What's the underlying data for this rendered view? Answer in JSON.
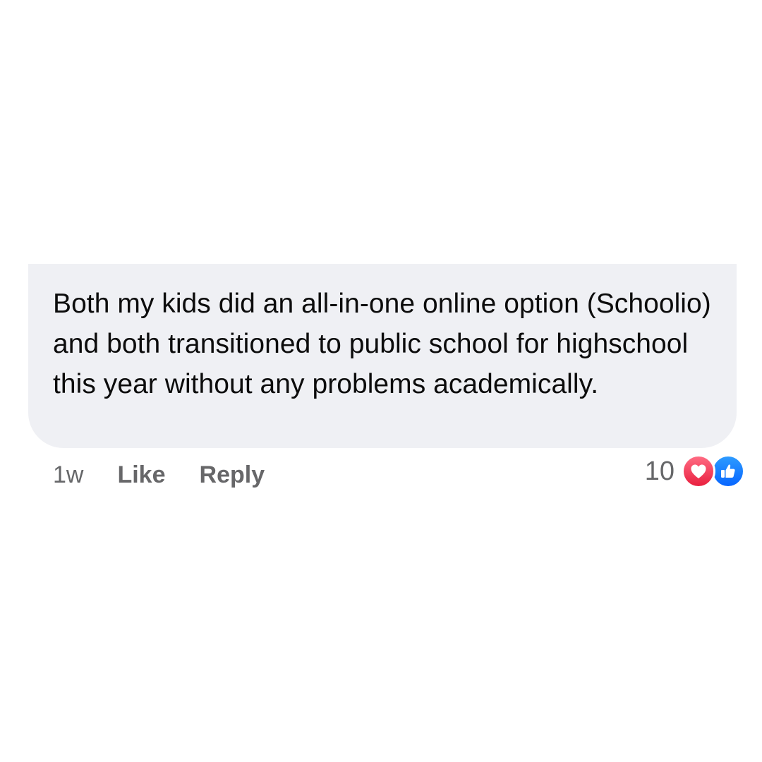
{
  "comment": {
    "text": "Both my kids did an all-in-one online option (Schoolio) and both transitioned to public school for highschool this year without any problems academically."
  },
  "meta": {
    "time": "1w",
    "like_label": "Like",
    "reply_label": "Reply"
  },
  "reactions": {
    "count": "10",
    "types": [
      "love",
      "like"
    ],
    "colors": {
      "love": "#f0284a",
      "like": "#0866ff",
      "bubble": "#eff0f4",
      "muted_text": "#666769"
    }
  }
}
